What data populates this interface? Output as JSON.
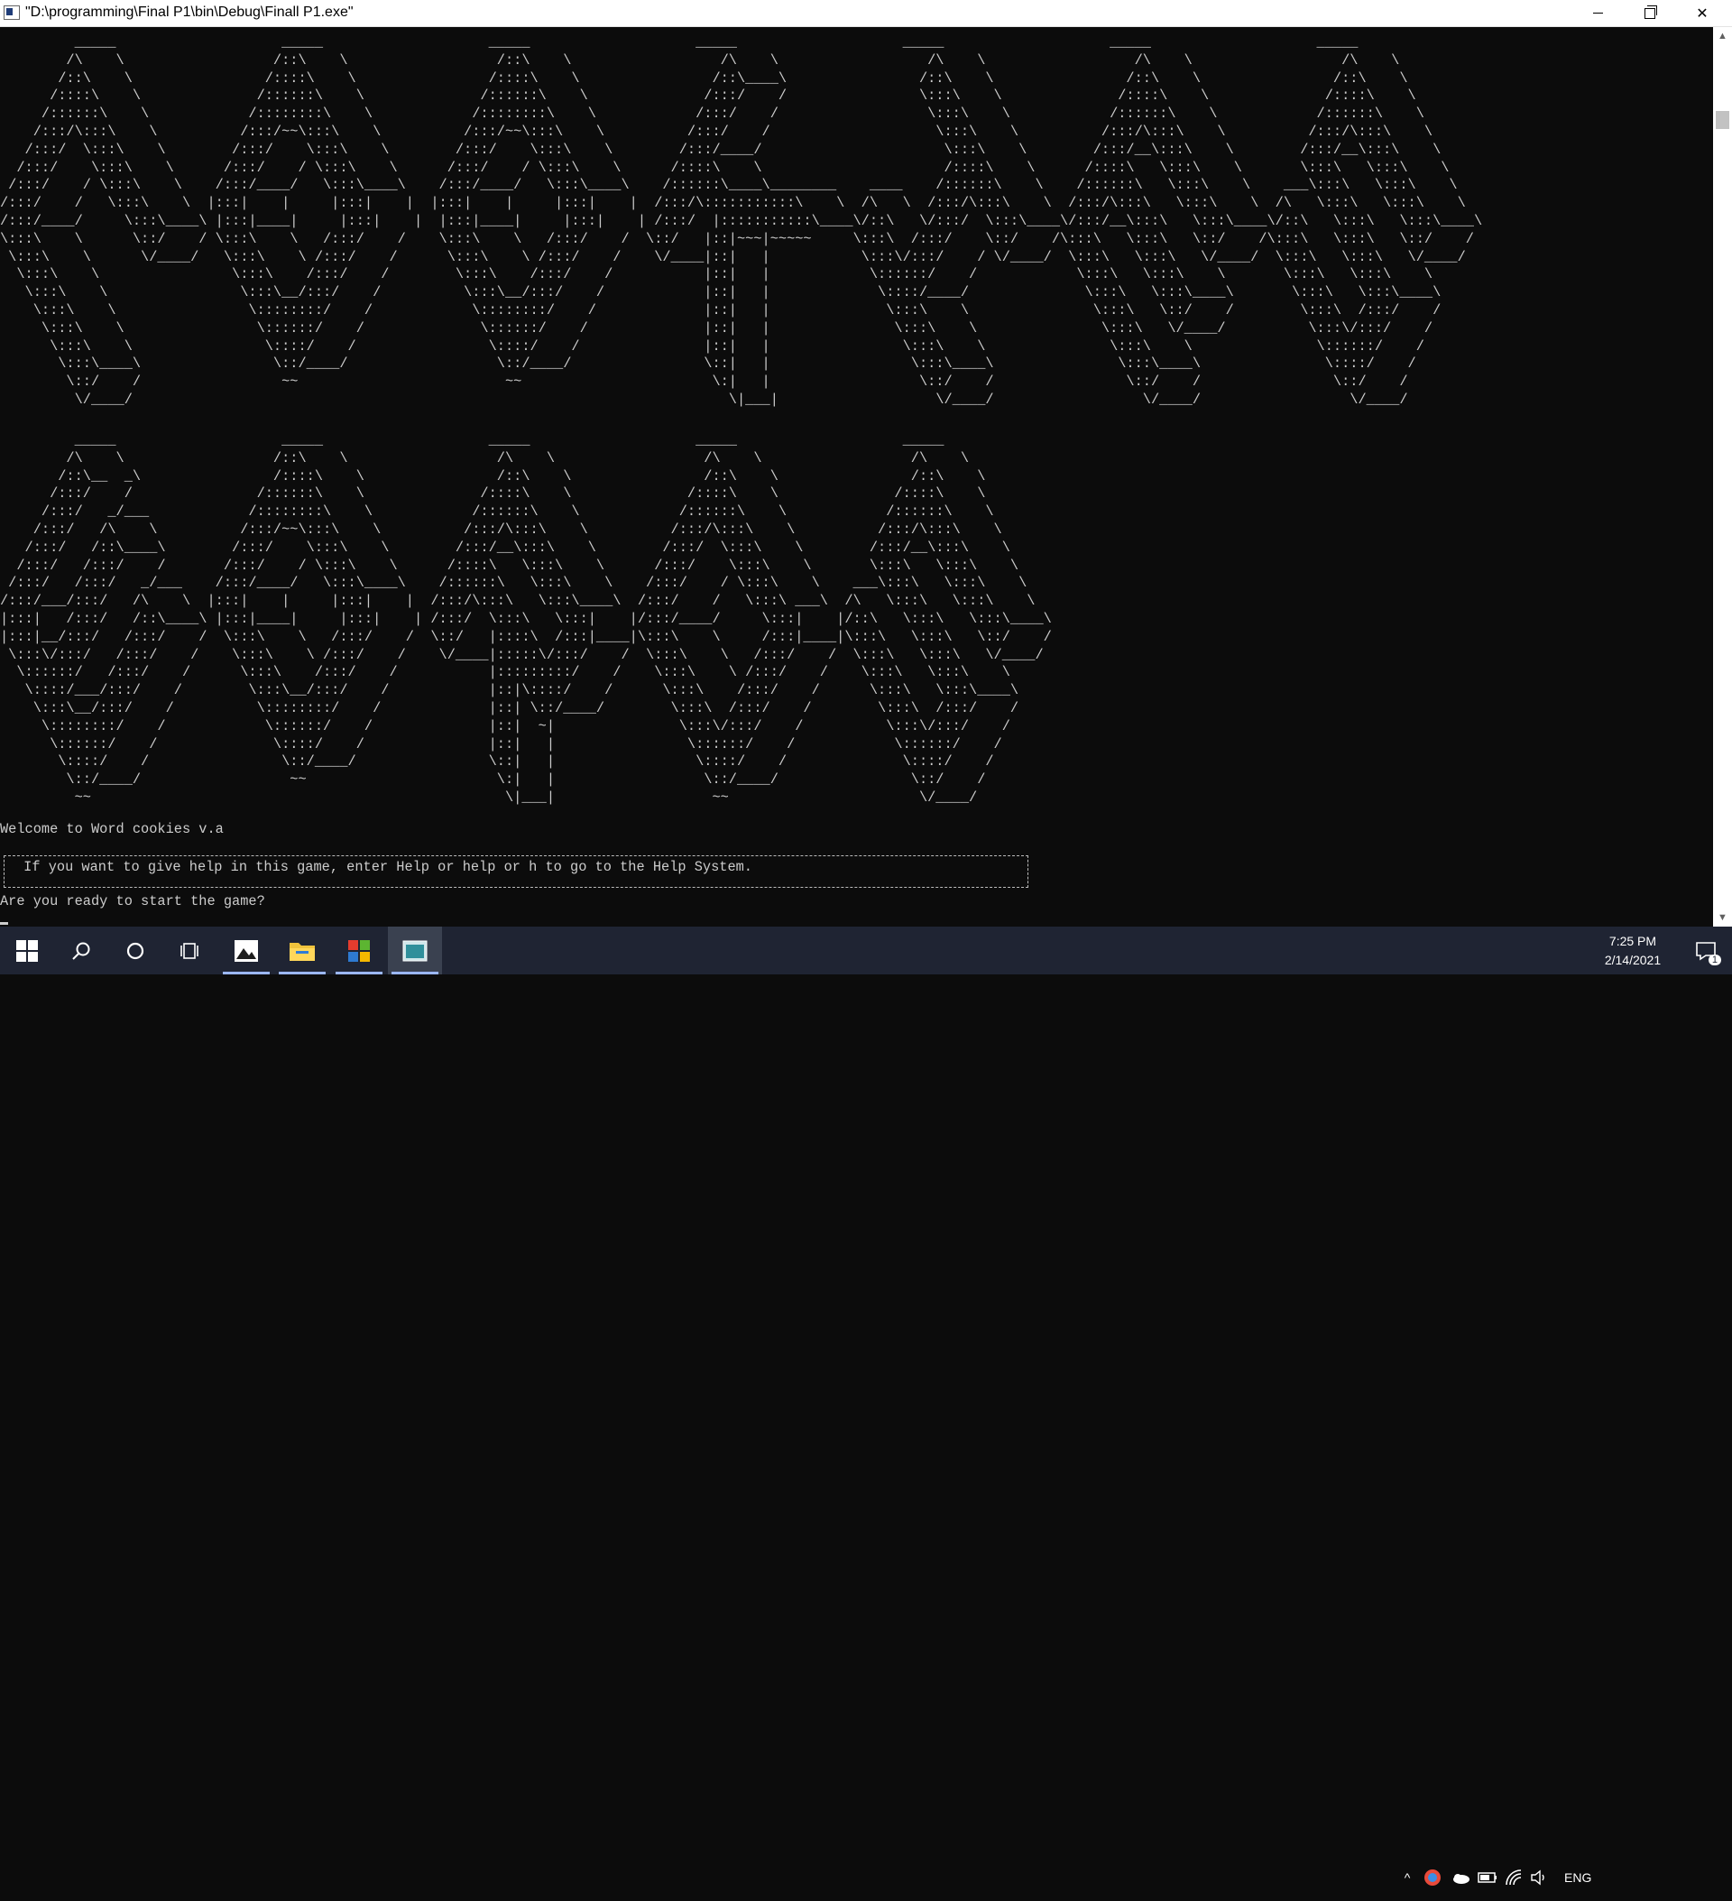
{
  "window": {
    "title": "\"D:\\programming\\Final P1\\bin\\Debug\\Finall P1.exe\"",
    "minimize_icon": "minimize-icon",
    "maximize_icon": "restore-icon",
    "close_icon": "close-icon"
  },
  "console": {
    "ascii_art_line1": "         _____                    _____                    _____                    _____                    _____                    _____                    _____          \n        /\\    \\                  /::\\    \\                  /::\\    \\                  /\\    \\                  /\\    \\                  /\\    \\                  /\\    \\         \n       /::\\    \\                /::::\\    \\                /::::\\    \\                /::\\____\\                /::\\    \\                /::\\    \\                /::\\    \\        \n      /::::\\    \\              /::::::\\    \\              /::::::\\    \\              /:::/    /                \\:::\\    \\              /::::\\    \\              /::::\\    \\       \n     /::::::\\    \\            /::::::::\\    \\            /::::::::\\    \\            /:::/    /                  \\:::\\    \\            /::::::\\    \\            /::::::\\    \\      \n    /:::/\\:::\\    \\          /:::/~~\\:::\\    \\          /:::/~~\\:::\\    \\          /:::/    /                    \\:::\\    \\          /:::/\\:::\\    \\          /:::/\\:::\\    \\     \n   /:::/  \\:::\\    \\        /:::/    \\:::\\    \\        /:::/    \\:::\\    \\        /:::/____/                      \\:::\\    \\        /:::/__\\:::\\    \\        /:::/__\\:::\\    \\    \n  /:::/    \\:::\\    \\      /:::/    / \\:::\\    \\      /:::/    / \\:::\\    \\      /::::\\    \\                      /::::\\    \\      /::::\\   \\:::\\    \\       \\:::\\   \\:::\\    \\   \n /:::/    / \\:::\\    \\    /:::/____/   \\:::\\____\\    /:::/____/   \\:::\\____\\    /::::::\\____\\________    ____    /::::::\\    \\    /::::::\\   \\:::\\    \\    ___\\:::\\   \\:::\\    \\  \n/:::/    /   \\:::\\    \\  |:::|    |     |:::|    |  |:::|    |     |:::|    |  /:::/\\:::::::::::\\    \\  /\\   \\  /:::/\\:::\\    \\  /:::/\\:::\\   \\:::\\    \\  /\\   \\:::\\   \\:::\\    \\ \n/:::/____/     \\:::\\____\\ |:::|____|     |:::|    |  |:::|____|     |:::|    | /:::/  |:::::::::::\\____\\/::\\   \\/:::/  \\:::\\____\\/:::/__\\:::\\   \\:::\\____\\/::\\   \\:::\\   \\:::\\____\\\n\\:::\\    \\      \\::/    / \\:::\\    \\   /:::/    /    \\:::\\    \\   /:::/    /  \\::/   |::|~~~|~~~~~     \\:::\\  /:::/    \\::/    /\\:::\\   \\:::\\   \\::/    /\\:::\\   \\:::\\   \\::/    /\n \\:::\\    \\      \\/____/   \\:::\\    \\ /:::/    /      \\:::\\    \\ /:::/    /    \\/____|::|   |           \\:::\\/:::/    / \\/____/  \\:::\\   \\:::\\   \\/____/  \\:::\\   \\:::\\   \\/____/ \n  \\:::\\    \\                \\:::\\    /:::/    /        \\:::\\    /:::/    /           |::|   |            \\::::::/    /            \\:::\\   \\:::\\    \\       \\:::\\   \\:::\\    \\     \n   \\:::\\    \\                \\:::\\__/:::/    /          \\:::\\__/:::/    /            |::|   |             \\::::/____/              \\:::\\   \\:::\\____\\       \\:::\\   \\:::\\____\\    \n    \\:::\\    \\                \\::::::::/    /            \\::::::::/    /             |::|   |              \\:::\\    \\               \\:::\\   \\::/    /        \\:::\\  /:::/    /    \n     \\:::\\    \\                \\::::::/    /              \\::::::/    /              |::|   |               \\:::\\    \\               \\:::\\   \\/____/          \\:::\\/:::/    /     \n      \\:::\\    \\                \\::::/    /                \\::::/    /               |::|   |                \\:::\\    \\               \\:::\\    \\               \\::::::/    /      \n       \\:::\\____\\                \\::/____/                  \\::/____/                \\::|   |                 \\:::\\____\\               \\:::\\____\\               \\::::/    /       \n        \\::/    /                 ~~                         ~~                       \\:|   |                  \\::/    /                \\::/    /                \\::/    /        \n         \\/____/                                                                        \\|___|                   \\/____/                  \\/____/                  \\/____/         ",
    "ascii_art_line2": "         _____                    _____                    _____                    _____                    _____          \n        /\\    \\                  /::\\    \\                  /\\    \\                  /\\    \\                  /\\    \\         \n       /::\\__  _\\                /::::\\    \\                /::\\    \\                /::\\    \\                /::\\    \\        \n      /:::/    /               /::::::\\    \\              /::::\\    \\              /::::\\    \\              /::::\\    \\       \n     /:::/   _/___            /::::::::\\    \\            /::::::\\    \\            /::::::\\    \\            /::::::\\    \\      \n    /:::/   /\\    \\          /:::/~~\\:::\\    \\          /:::/\\:::\\    \\          /:::/\\:::\\    \\          /:::/\\:::\\    \\     \n   /:::/   /::\\____\\        /:::/    \\:::\\    \\        /:::/__\\:::\\    \\        /:::/  \\:::\\    \\        /:::/__\\:::\\    \\    \n  /:::/   /:::/    /       /:::/    / \\:::\\    \\      /::::\\   \\:::\\    \\      /:::/    \\:::\\    \\       \\:::\\   \\:::\\    \\   \n /:::/   /:::/   _/___    /:::/____/   \\:::\\____\\    /::::::\\   \\:::\\    \\    /:::/    / \\:::\\    \\    ___\\:::\\   \\:::\\    \\  \n/:::/___/:::/   /\\    \\  |:::|    |     |:::|    |  /:::/\\:::\\   \\:::\\____\\  /:::/    /   \\:::\\ ___\\  /\\   \\:::\\   \\:::\\    \\ \n|:::|   /:::/   /::\\____\\ |:::|____|     |:::|    | /:::/  \\:::\\   \\:::|    |/:::/____/     \\:::|    |/::\\   \\:::\\   \\:::\\____\\\n|:::|__/:::/   /:::/    /  \\:::\\    \\   /:::/    /  \\::/   |::::\\  /:::|____|\\:::\\    \\     /:::|____|\\:::\\   \\:::\\   \\::/    /\n \\:::\\/:::/   /:::/    /    \\:::\\    \\ /:::/    /    \\/____|:::::\\/:::/    /  \\:::\\    \\   /:::/    /  \\:::\\   \\:::\\   \\/____/ \n  \\::::::/   /:::/    /      \\:::\\    /:::/    /           |:::::::::/    /    \\:::\\    \\ /:::/    /    \\:::\\   \\:::\\    \\     \n   \\::::/___/:::/    /        \\:::\\__/:::/    /            |::|\\::::/    /      \\:::\\    /:::/    /      \\:::\\   \\:::\\____\\    \n    \\:::\\__/:::/    /          \\::::::::/    /             |::| \\::/____/        \\:::\\  /:::/    /        \\:::\\  /:::/    /    \n     \\::::::::/    /            \\::::::/    /              |::|  ~|               \\:::\\/:::/    /          \\:::\\/:::/    /     \n      \\::::::/    /              \\::::/    /               |::|   |                \\::::::/    /            \\::::::/    /      \n       \\::::/    /                \\::/____/                \\::|   |                 \\::::/    /              \\::::/    /       \n        \\::/____/                  ~~                       \\:|   |                  \\::/____/                \\::/    /        \n         ~~                                                  \\|___|                   ~~                       \\/____/         ",
    "welcome": "Welcome to Word cookies v.a",
    "help_message": " If you want to give help in this game, enter Help or help or h to go to the Help System.",
    "prompt": "Are you ready to start the game?"
  },
  "scrollbar": {
    "up_icon": "chevron-up-icon",
    "down_icon": "chevron-down-icon"
  },
  "taskbar": {
    "start_icon": "windows-start-icon",
    "search_icon": "search-icon",
    "cortana_icon": "cortana-circle-icon",
    "taskview_icon": "task-view-icon",
    "apps": [
      {
        "name": "photos-icon",
        "active": true
      },
      {
        "name": "file-explorer-icon",
        "active": true
      },
      {
        "name": "app-grid-icon",
        "active": true
      },
      {
        "name": "console-app-icon",
        "active": true
      }
    ],
    "tray": {
      "language": "ENG",
      "time": "7:25 PM",
      "date": "2/14/2021",
      "notification_count": "1"
    }
  }
}
